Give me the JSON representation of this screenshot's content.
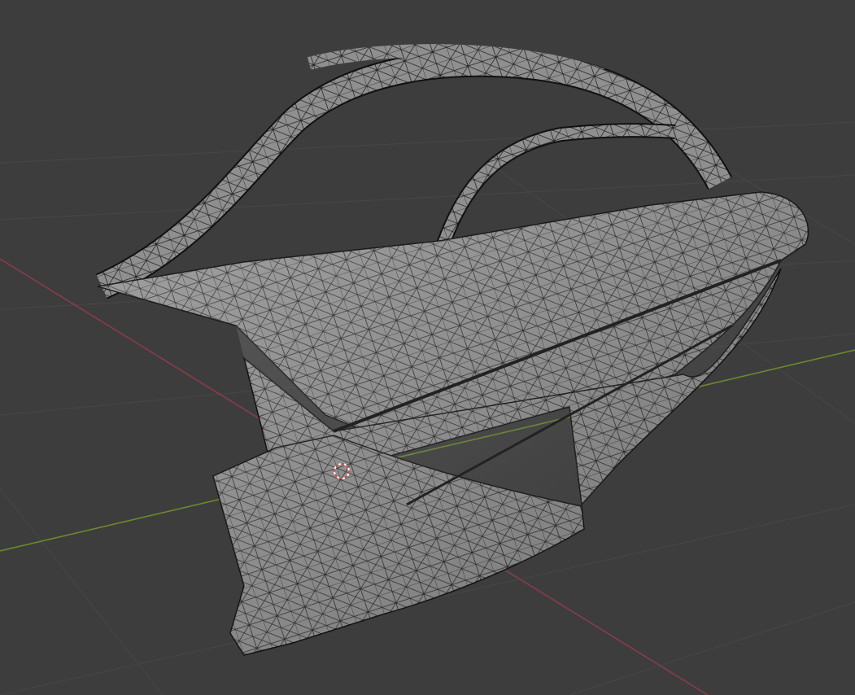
{
  "viewport": {
    "background": "#3d3d3d",
    "grid_color": "#474747",
    "x_axis_color": "#8c3b4a",
    "y_axis_color": "#6b8a2c",
    "mesh_fill": "#8e8e8e",
    "wire_color": "#1e1e1e",
    "cursor_color": "#e04040"
  }
}
